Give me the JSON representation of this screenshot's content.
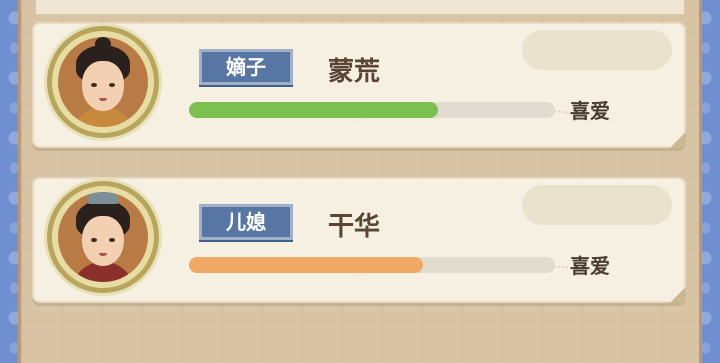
{
  "colors": {
    "bar_green": "#7cc150",
    "bar_orange": "#f0a865",
    "tag_blue": "#5876a4"
  },
  "cards": [
    {
      "role": "嫡子",
      "name": "蒙荒",
      "relation": "喜爱",
      "affection_fraction": 0.68,
      "avatar": "young-man-with-bun-avatar"
    },
    {
      "role": "儿媳",
      "name": "干华",
      "relation": "喜爱",
      "affection_fraction": 0.64,
      "avatar": "man-with-headpiece-avatar"
    }
  ]
}
